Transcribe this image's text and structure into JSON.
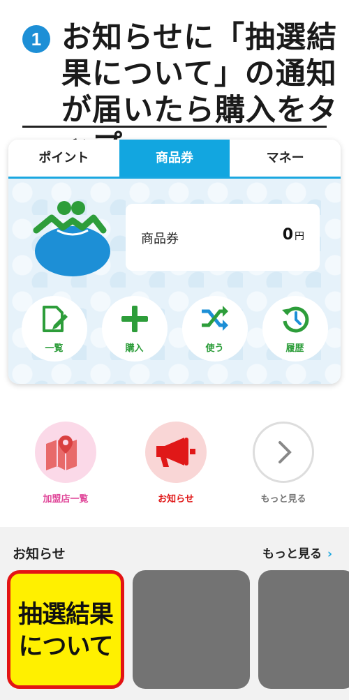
{
  "instruction": {
    "step": "1",
    "text": "お知らせに「抽選結果について」の通知が届いたら購入をタップ"
  },
  "tabs": [
    {
      "label": "ポイント",
      "active": false
    },
    {
      "label": "商品券",
      "active": true
    },
    {
      "label": "マネー",
      "active": false
    }
  ],
  "balance": {
    "label": "商品券",
    "value": "0",
    "unit": "円"
  },
  "actions": [
    {
      "label": "一覧",
      "icon": "document-edit-icon"
    },
    {
      "label": "購入",
      "icon": "plus-icon"
    },
    {
      "label": "使う",
      "icon": "shuffle-icon"
    },
    {
      "label": "履歴",
      "icon": "history-icon"
    }
  ],
  "shortcuts": [
    {
      "label": "加盟店一覧",
      "icon": "map-pin-icon",
      "color": "#e0489a"
    },
    {
      "label": "お知らせ",
      "icon": "megaphone-icon",
      "color": "#e01818"
    },
    {
      "label": "もっと見る",
      "icon": "chevron-right-icon",
      "color": "#888888"
    }
  ],
  "news": {
    "title": "お知らせ",
    "more_label": "もっと見る",
    "more_chevron": "›",
    "featured": {
      "line1": "抽選結果",
      "line2": "について"
    }
  },
  "colors": {
    "accent": "#12a6e0",
    "action_green": "#2d9d3a",
    "featured_bg": "#fff000",
    "featured_border": "#e31414"
  }
}
